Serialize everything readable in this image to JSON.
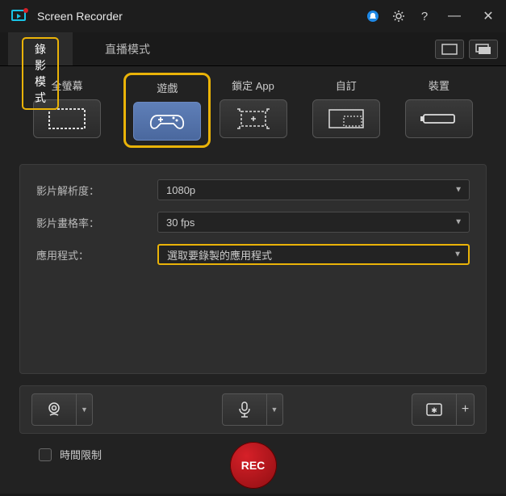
{
  "app": {
    "title": "Screen Recorder"
  },
  "titlebar_icons": {
    "bell": "notification-icon",
    "gear": "settings-icon",
    "help": "?",
    "min": "—",
    "close": "✕"
  },
  "tabs": {
    "record": "錄影模式",
    "stream": "直播模式"
  },
  "modes": [
    {
      "key": "fullscreen",
      "label": "全螢幕"
    },
    {
      "key": "game",
      "label": "遊戲"
    },
    {
      "key": "lockapp",
      "label": "鎖定 App"
    },
    {
      "key": "custom",
      "label": "自訂"
    },
    {
      "key": "device",
      "label": "裝置"
    }
  ],
  "settings": {
    "resolution_label": "影片解析度：",
    "resolution_value": "1080p",
    "fps_label": "影片畫格率：",
    "fps_value": "30 fps",
    "app_label": "應用程式：",
    "app_value": "選取要錄製的應用程式"
  },
  "footer": {
    "timelimit": "時間限制",
    "rec": "REC"
  }
}
